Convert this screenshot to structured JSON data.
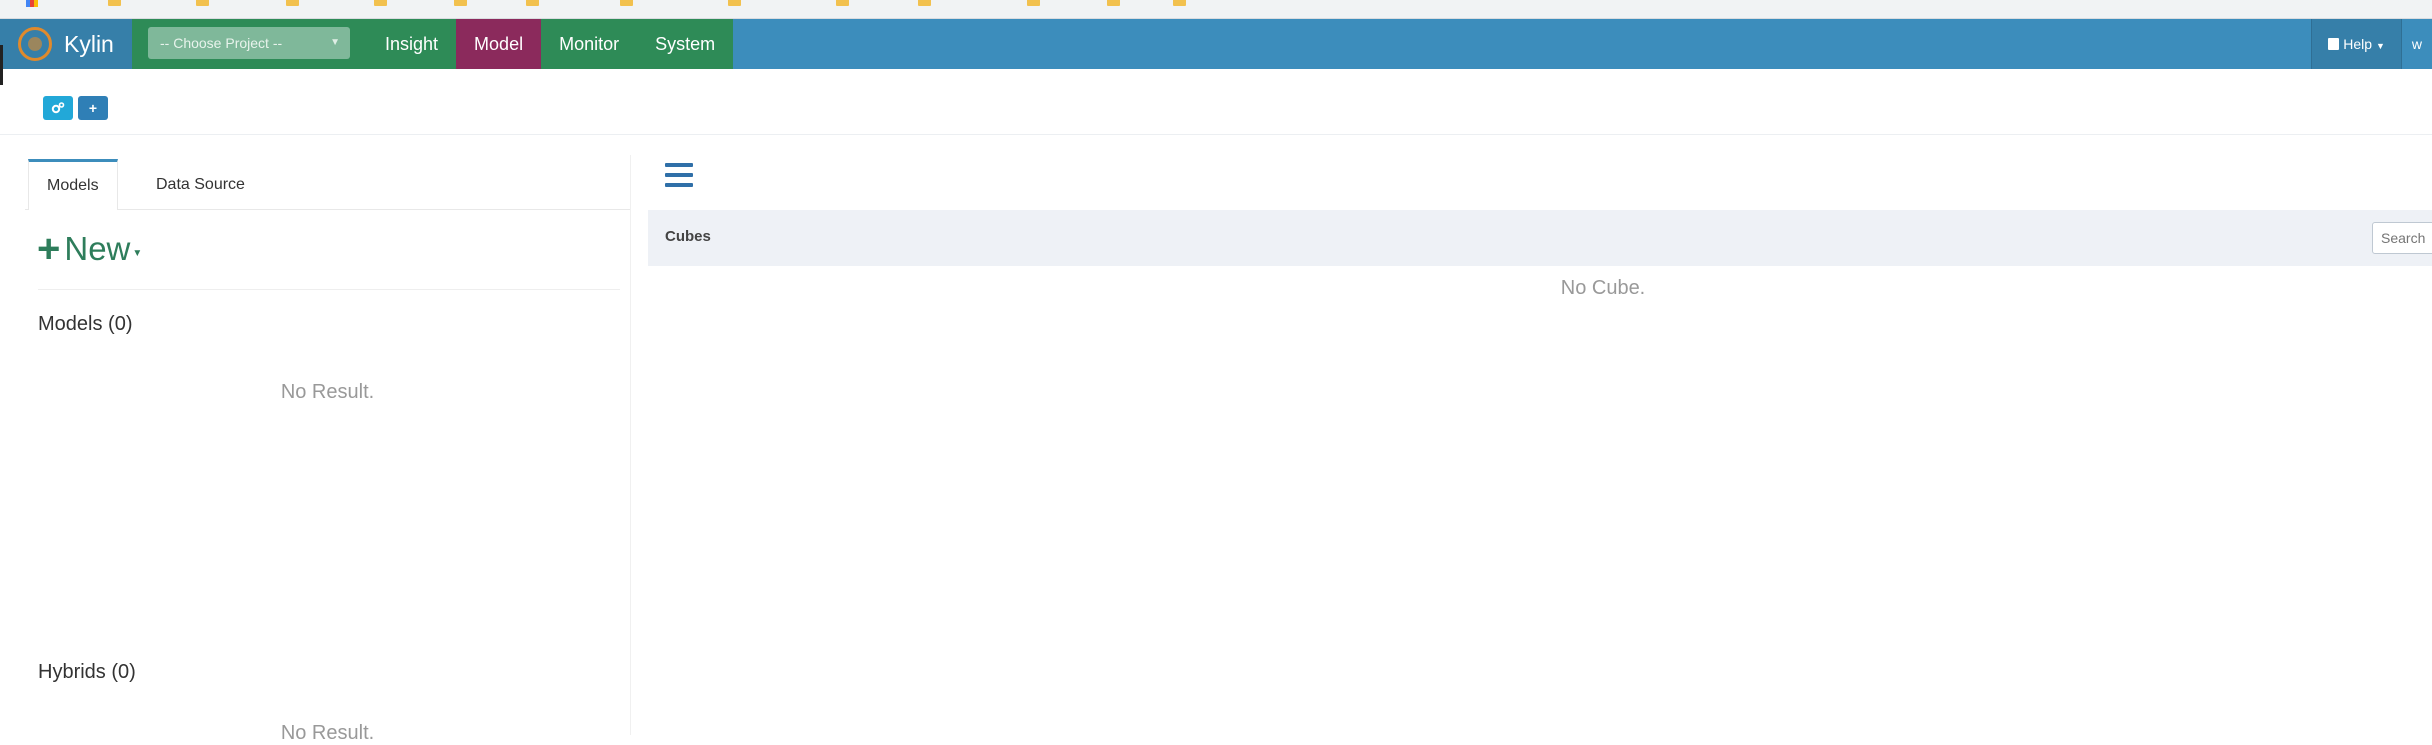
{
  "app": {
    "brand": "Kylin"
  },
  "header": {
    "project_placeholder": "-- Choose Project --",
    "tabs": [
      {
        "label": "Insight"
      },
      {
        "label": "Model"
      },
      {
        "label": "Monitor"
      },
      {
        "label": "System"
      }
    ],
    "active_tab": "Model",
    "help_label": "Help",
    "user_label": "w"
  },
  "toolbar": {
    "buttons": [
      {
        "icon": "gears-icon"
      },
      {
        "icon": "plus-icon",
        "label": "+"
      }
    ]
  },
  "left": {
    "tabs": [
      {
        "label": "Models"
      },
      {
        "label": "Data Source"
      }
    ],
    "new_label": "New",
    "models_title": "Models (0)",
    "models_empty": "No Result.",
    "hybrids_title": "Hybrids (0)",
    "hybrids_empty": "No Result."
  },
  "right": {
    "cubes_title": "Cubes",
    "search_placeholder": "Search",
    "empty": "No Cube."
  },
  "colors": {
    "navbar": "#3c8dbc",
    "nav_green": "#2e8b57",
    "nav_active": "#8b2a5c",
    "new_green": "#2e7d5b"
  }
}
